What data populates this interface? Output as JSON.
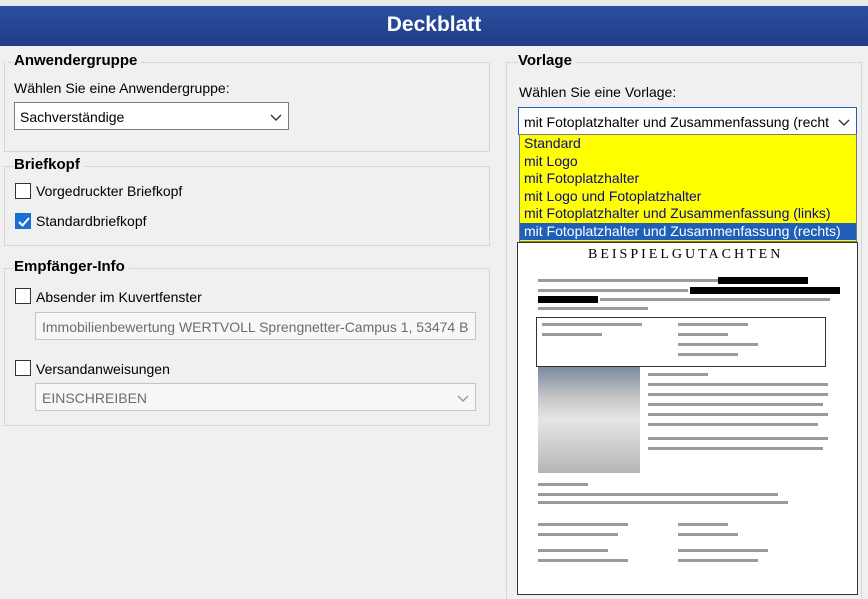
{
  "window": {
    "title": "Deckblatt"
  },
  "anwendergruppe": {
    "heading": "Anwendergruppe",
    "prompt": "Wählen Sie eine Anwendergruppe:",
    "selected": "Sachverständige"
  },
  "briefkopf": {
    "heading": "Briefkopf",
    "options": [
      {
        "label": "Vorgedruckter Briefkopf",
        "checked": false
      },
      {
        "label": "Standardbriefkopf",
        "checked": true
      }
    ]
  },
  "empfaenger": {
    "heading": "Empfänger-Info",
    "absender_label": "Absender im Kuvertfenster",
    "absender_value": "Immobilienbewertung WERTVOLL Sprengnetter-Campus 1, 53474 B",
    "versand_label": "Versandanweisungen",
    "versand_value": "EINSCHREIBEN"
  },
  "vorlage": {
    "heading": "Vorlage",
    "prompt": "Wählen Sie eine Vorlage:",
    "selected": "mit Fotoplatzhalter und Zusammenfassung (recht",
    "options": [
      "Standard",
      "mit Logo",
      "mit Fotoplatzhalter",
      "mit Logo und Fotoplatzhalter",
      "mit Fotoplatzhalter und Zusammenfassung (links)",
      "mit Fotoplatzhalter und Zusammenfassung (rechts)"
    ],
    "highlight_color": "#ffff00",
    "selected_color": "#1f5fb8"
  },
  "preview": {
    "title": "BEISPIELGUTACHTEN"
  }
}
